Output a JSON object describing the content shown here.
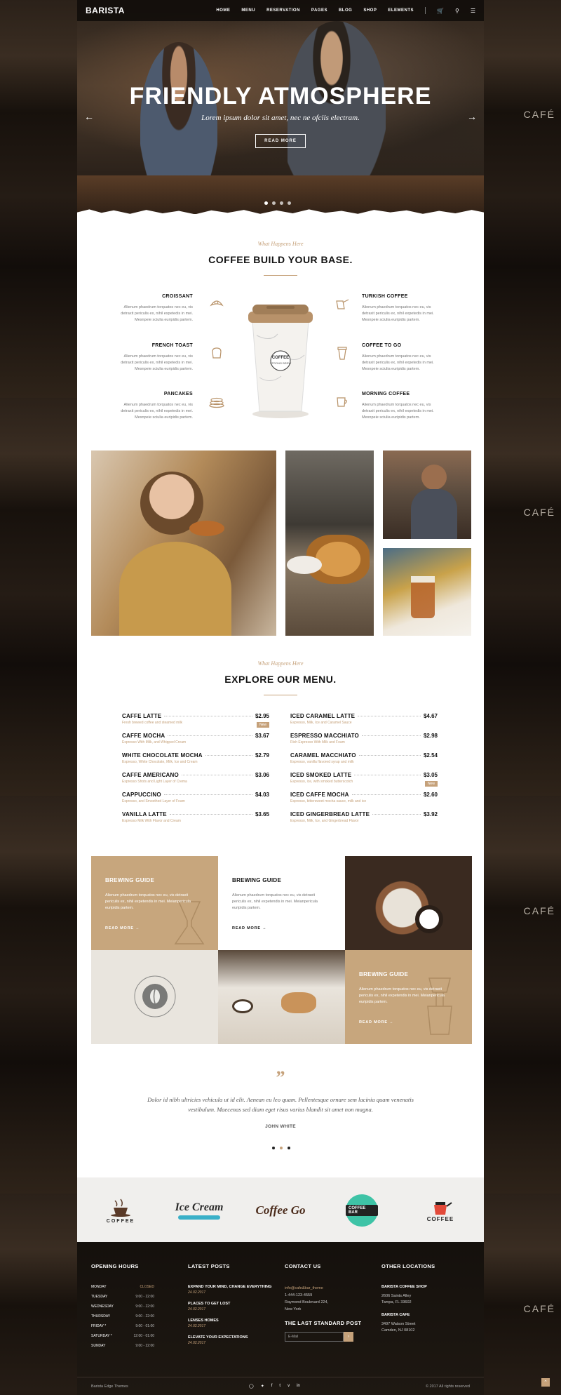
{
  "brand": "BARISTA",
  "side_sign": "CAFÉ",
  "nav": [
    "HOME",
    "MENU",
    "RESERVATION",
    "PAGES",
    "BLOG",
    "SHOP",
    "ELEMENTS"
  ],
  "hero": {
    "title": "FRIENDLY ATMOSPHERE",
    "subtitle": "Lorem ipsum dolor sit amet, nec ne ofciis electram.",
    "button": "READ MORE",
    "slides": 4,
    "active_slide": 1
  },
  "features_section": {
    "kicker": "What Happens Here",
    "title": "COFFEE BUILD YOUR BASE.",
    "cup_text": "COFFEE",
    "cup_subtext": "STRONG BREW",
    "left": [
      {
        "title": "CROISSANT",
        "text": "Alienum phaedrum torquatos nec eu, vis detraxit periculis ex, nihil expetedis in mei. Mesnpeie sciulia euripidis partem.",
        "icon": "croissant-icon"
      },
      {
        "title": "FRENCH TOAST",
        "text": "Alienum phaedrum torquatos nec eu, vis detraxit periculis ex, nihil expetedis in mei. Mesnpeie sciulia euripidis partem.",
        "icon": "toast-icon"
      },
      {
        "title": "PANCAKES",
        "text": "Alienum phaedrum torquatos nec eu, vis detraxit periculis ex, nihil expetedis in mei. Mesnpeie sciulia euripidis partem.",
        "icon": "pancakes-icon"
      }
    ],
    "right": [
      {
        "title": "TURKISH COFFEE",
        "text": "Alienum phaedrum torquatos nec eu, vis detraxit periculis ex, nihil expetedis in mei. Mesnpeie sciulia euripidis partem.",
        "icon": "cezve-icon"
      },
      {
        "title": "COFFEE TO GO",
        "text": "Alienum phaedrum torquatos nec eu, vis detraxit periculis ex, nihil expetedis in mei. Mesnpeie sciulia euripidis partem.",
        "icon": "takeaway-cup-icon"
      },
      {
        "title": "MORNING COFFEE",
        "text": "Alienum phaedrum torquatos nec eu, vis detraxit periculis ex, nihil expetedis in mei. Mesnpeie sciulia euripidis partem.",
        "icon": "mug-icon"
      }
    ]
  },
  "menu_section": {
    "kicker": "What Happens Here",
    "title": "EXPLORE OUR MENU.",
    "left": [
      {
        "name": "CAFFE LATTE",
        "price": "$2.95",
        "desc": "Fresh brewed coffee and steamed milk",
        "badge": "New"
      },
      {
        "name": "CAFFE MOCHA",
        "price": "$3.67",
        "desc": "Espresso With Milk, and Whipped Cream"
      },
      {
        "name": "WHITE CHOCOLATE MOCHA",
        "price": "$2.79",
        "desc": "Espresso, White Chocolate, Milk, Ice and Cream"
      },
      {
        "name": "CAFFE AMERICANO",
        "price": "$3.06",
        "desc": "Espresso Shots and Light Layer of Crema"
      },
      {
        "name": "CAPPUCCINO",
        "price": "$4.03",
        "desc": "Espresso, and Smoothed Layer of Foam"
      },
      {
        "name": "VANILLA LATTE",
        "price": "$3.65",
        "desc": "Espresso Milk With Flavor and Cream"
      }
    ],
    "right": [
      {
        "name": "ICED CARAMEL LATTE",
        "price": "$4.67",
        "desc": "Espresso, Milk, Ice and Caramel Sauce"
      },
      {
        "name": "ESPRESSO MACCHIATO",
        "price": "$2.98",
        "desc": "Rich Espresso With Milk and Foam"
      },
      {
        "name": "CARAMEL MACCHIATO",
        "price": "$2.54",
        "desc": "Espresso, vanilla flavored syrup and milk"
      },
      {
        "name": "ICED SMOKED LATTE",
        "price": "$3.05",
        "desc": "Espresso, ice, with smoked butterscotch",
        "badge": "New"
      },
      {
        "name": "ICED CAFFE MOCHA",
        "price": "$2.60",
        "desc": "Espresso, bittersweet mocha sauce, milk and ice"
      },
      {
        "name": "ICED GINGERBREAD LATTE",
        "price": "$3.92",
        "desc": "Espresso, Milk, Ice, and Gingerbread Flavor"
      }
    ]
  },
  "guides": {
    "title": "BREWING GUIDE",
    "text": "Alienum phaedrum torquatos nec eu, vis detraxit periculis ex, nihil expetendis in mei. Meianpericula euripidis partem.",
    "more": "READ MORE",
    "badge_text": "COFFEE SHOP · RETRO STYLE"
  },
  "testimonial": {
    "quote": "Dolor id nibh ultricies vehicula ut id elit. Aenean eu leo quam. Pellentesque ornare sem lacinia quam venenatis vestibulum. Maecenas sed diam eget risus varius blandit sit amet non magna.",
    "author": "JOHN WHITE"
  },
  "logos": [
    "COFFEE",
    "Ice Cream",
    "Coffee Go",
    "COFFEE BAR",
    "COFFEE"
  ],
  "footer": {
    "hours_title": "OPENING HOURS",
    "hours": [
      {
        "day": "MONDAY",
        "time": "CLOSED",
        "closed": true
      },
      {
        "day": "TUESDAY",
        "time": "9:00 - 22:00"
      },
      {
        "day": "WEDNESDAY",
        "time": "9:00 - 22:00"
      },
      {
        "day": "THURSDAY",
        "time": "9:00 - 22:00"
      },
      {
        "day": "FRIDAY *",
        "time": "9:00 - 01:00"
      },
      {
        "day": "SATURDAY *",
        "time": "12:00 - 01:00"
      },
      {
        "day": "SUNDAY",
        "time": "9:00 - 22:00"
      }
    ],
    "posts_title": "LATEST POSTS",
    "posts": [
      {
        "title": "EXPAND YOUR MIND, CHANGE EVERYTHING",
        "date": "24.02.2017"
      },
      {
        "title": "PLACES TO GET LOST",
        "date": "24.02.2017"
      },
      {
        "title": "LENSES HOMES",
        "date": "24.02.2017"
      },
      {
        "title": "ELEVATE YOUR EXPECTATIONS",
        "date": "24.02.2017"
      }
    ],
    "contact_title": "CONTACT US",
    "email": "info@cafe&bar_theme",
    "phone": "1-444-123-4559",
    "address1": "Raymond Boulevard 224,",
    "address2": "New York",
    "newsletter_title": "THE LAST STANDARD POST",
    "newsletter_placeholder": "E-Mail",
    "other_title": "OTHER LOCATIONS",
    "locations": [
      {
        "name": "BARISTA COFFEE SHOP",
        "line1": "2606 Saints Alley",
        "line2": "Tampa, FL 33602"
      },
      {
        "name": "BARISTA CAFE",
        "line1": "3497 Watson Street",
        "line2": "Camden, NJ 08102"
      }
    ],
    "bottom_left": "Barista Edge Themes",
    "copyright": "© 2017 All rights reserved",
    "social": [
      "instagram-icon",
      "twitter-icon",
      "facebook-icon",
      "tumblr-icon",
      "vimeo-icon",
      "linkedin-icon"
    ]
  },
  "colors": {
    "accent": "#c5a17a",
    "dark": "#1c1611",
    "tan_tile": "#c7a67d"
  }
}
